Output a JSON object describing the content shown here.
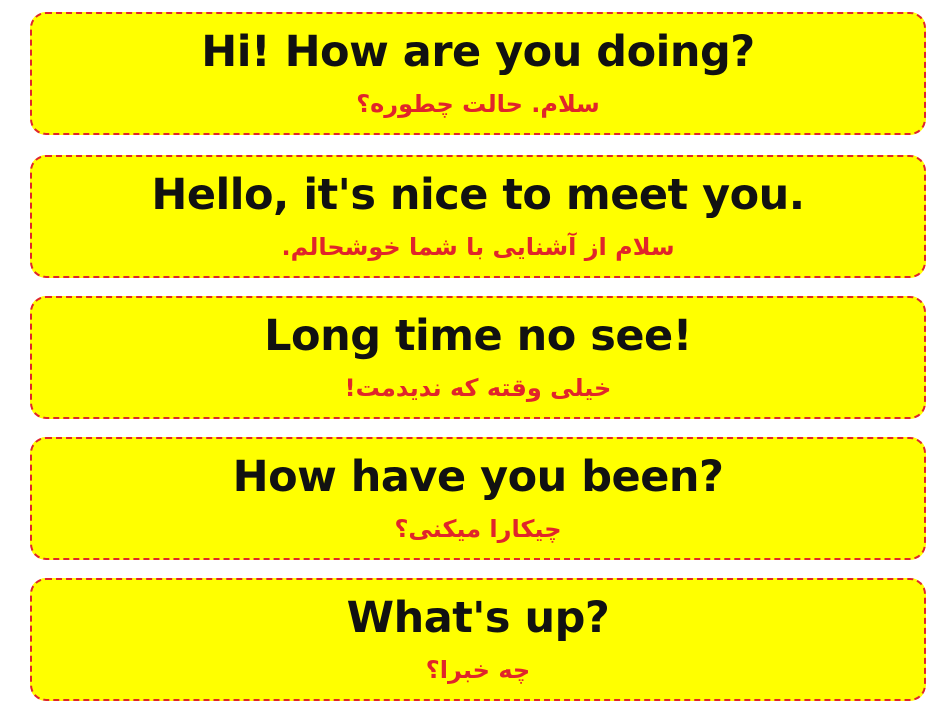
{
  "phrases": [
    {
      "english": "Hi! How are you doing?",
      "persian": "سلام. حالت چطوره؟"
    },
    {
      "english": "Hello, it's nice to meet you.",
      "persian": "سلام از آشنایی با شما خوشحالم."
    },
    {
      "english": "Long time no see!",
      "persian": "خیلی وقته که ندیدمت!"
    },
    {
      "english": "How have you been?",
      "persian": "چیکارا میکنی؟"
    },
    {
      "english": "What's up?",
      "persian": "چه خبرا؟"
    }
  ],
  "colors": {
    "card_background": "#ffff00",
    "card_border": "#e0252b",
    "english_text": "#111111",
    "persian_text": "#e0252b"
  }
}
